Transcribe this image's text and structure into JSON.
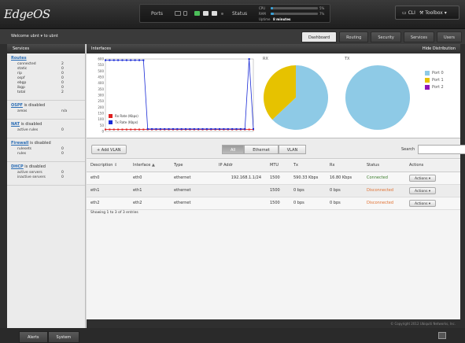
{
  "app": {
    "logo": "EdgeOS"
  },
  "status": {
    "ports_label": "Ports",
    "status_label": "Status",
    "cpu_label": "CPU",
    "ram_label": "RAM",
    "cpu_percent": "5%",
    "ram_percent": "7%",
    "cpu_value": 0.05,
    "ram_value": 0.07,
    "uptime_label": "Uptime",
    "uptime_value": "8 minutes"
  },
  "toolbox": {
    "cli_label": "CLI",
    "toolbox_label": "Toolbox"
  },
  "welcome": {
    "text": "Welcome ubnt  ▾    to ubnt"
  },
  "nav_tabs": [
    "Dashboard",
    "Routing",
    "Security",
    "Services",
    "Users"
  ],
  "sidebar": {
    "title": "Services",
    "routes": {
      "title": "Routes",
      "rows": [
        {
          "label": "connected",
          "value": "2"
        },
        {
          "label": "static",
          "value": "0"
        },
        {
          "label": "rip",
          "value": "0"
        },
        {
          "label": "ospf",
          "value": "0"
        },
        {
          "label": "ebgp",
          "value": "0"
        },
        {
          "label": "ibgp",
          "value": "0"
        },
        {
          "label": "total",
          "value": "2"
        }
      ]
    },
    "ospf": {
      "link": "OSPF",
      "suffix": " is disabled",
      "rows": [
        {
          "label": "areas",
          "value": "n/a"
        }
      ]
    },
    "nat": {
      "link": "NAT",
      "suffix": " is disabled",
      "rows": [
        {
          "label": "active rules",
          "value": "0"
        }
      ]
    },
    "firewall": {
      "link": "Firewall",
      "suffix": " is disabled",
      "rows": [
        {
          "label": "rulesets",
          "value": "0"
        },
        {
          "label": "rules",
          "value": "0"
        }
      ]
    },
    "dhcp": {
      "link": "DHCP",
      "suffix": " is disabled",
      "rows": [
        {
          "label": "active servers",
          "value": "0"
        },
        {
          "label": "inactive servers",
          "value": "0"
        }
      ]
    }
  },
  "interfaces_panel": {
    "title": "Interfaces",
    "hide_label": "Hide Distribution"
  },
  "chart_data": [
    {
      "type": "line",
      "x": [
        0,
        1,
        2,
        3,
        4,
        5,
        6,
        7,
        8,
        9,
        10,
        11,
        12,
        13,
        14,
        15,
        16,
        17,
        18,
        19,
        20,
        21,
        22,
        23,
        24,
        25,
        26,
        27,
        28,
        29,
        30,
        31,
        32,
        33,
        34,
        35
      ],
      "series": [
        {
          "name": "Rx Rate (Kbps)",
          "color": "#e02020",
          "values": [
            16,
            16,
            16,
            16,
            16,
            16,
            16,
            16,
            16,
            16,
            16,
            16,
            16,
            16,
            16,
            16,
            16,
            16,
            16,
            16,
            16,
            16,
            16,
            16,
            16,
            16,
            16,
            16,
            16,
            16,
            16,
            16,
            16,
            16,
            16,
            16
          ]
        },
        {
          "name": "Tx Rate (Kbps)",
          "color": "#1a2bd6",
          "values": [
            590,
            590,
            590,
            590,
            590,
            590,
            590,
            590,
            590,
            590,
            20,
            20,
            20,
            20,
            20,
            20,
            20,
            20,
            20,
            20,
            20,
            20,
            20,
            20,
            20,
            20,
            20,
            20,
            20,
            20,
            20,
            20,
            20,
            20,
            600,
            20
          ]
        }
      ],
      "yticks": [
        0,
        50,
        100,
        150,
        200,
        250,
        300,
        350,
        400,
        450,
        500,
        550,
        600
      ],
      "ylim": [
        0,
        600
      ]
    },
    {
      "type": "pie",
      "title": "RX",
      "labels": [
        "Port 0",
        "Port 1"
      ],
      "values": [
        63,
        37
      ],
      "colors": [
        "#8ecae6",
        "#e6c200"
      ]
    },
    {
      "type": "pie",
      "title": "TX",
      "labels": [
        "Port 0"
      ],
      "values": [
        100
      ],
      "colors": [
        "#8ecae6"
      ]
    }
  ],
  "pie_legend": [
    {
      "label": "Port 0",
      "color": "#8ecae6"
    },
    {
      "label": "Port 1",
      "color": "#e6c200"
    },
    {
      "label": "Port 2",
      "color": "#8e14b8"
    }
  ],
  "toolbar": {
    "add_vlan": "+ Add VLAN",
    "filters": [
      "All",
      "Ethernet",
      "VLAN"
    ],
    "search_label": "Search"
  },
  "table": {
    "headers": [
      "Description",
      "Interface",
      "Type",
      "IP Addr",
      "MTU",
      "Tx",
      "Rx",
      "Status",
      "Actions"
    ],
    "rows": [
      {
        "description": "eth0",
        "interface": "eth0",
        "type": "ethernet",
        "ip": "192.168.1.1/24",
        "mtu": "1500",
        "tx": "590.33 Kbps",
        "rx": "16.80 Kbps",
        "status": "Connected",
        "action": "Actions"
      },
      {
        "description": "eth1",
        "interface": "eth1",
        "type": "ethernet",
        "ip": "",
        "mtu": "1500",
        "tx": "0 bps",
        "rx": "0 bps",
        "status": "Disconnected",
        "action": "Actions"
      },
      {
        "description": "eth2",
        "interface": "eth2",
        "type": "ethernet",
        "ip": "",
        "mtu": "1500",
        "tx": "0 bps",
        "rx": "0 bps",
        "status": "Disconnected",
        "action": "Actions"
      }
    ],
    "showing": "Showing 1 to 3 of 3 entries"
  },
  "copyright": "© Copyright 2012 Ubiquiti Networks, Inc.",
  "footer": {
    "tabs": [
      "Alerts",
      "System"
    ]
  },
  "icons": {
    "port": "ethernet-port-icon",
    "cli": "terminal-icon",
    "toolbox": "wrench-icon",
    "sort": "sort-arrows-icon"
  }
}
